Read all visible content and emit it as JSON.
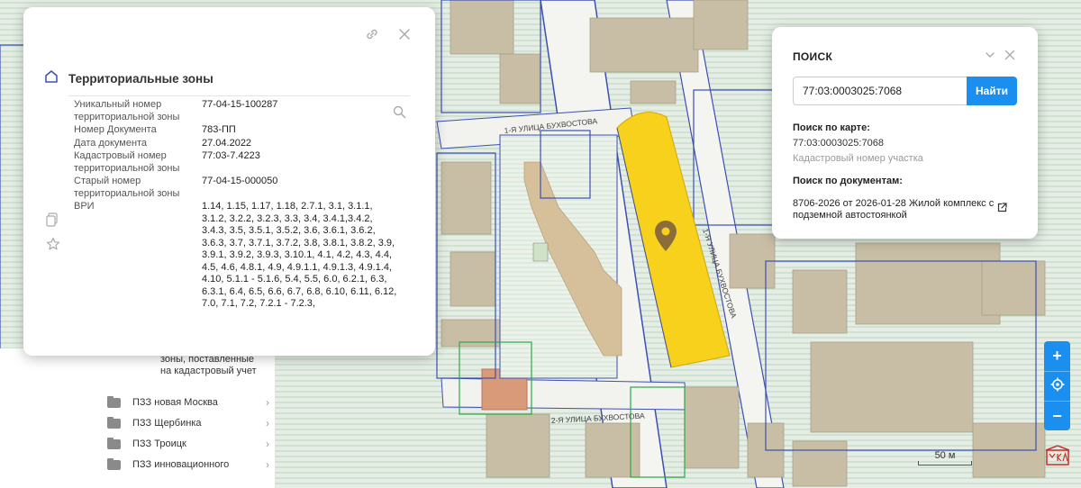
{
  "map": {
    "streets": [
      "1-Я УЛИЦА БУХВОСТОВА",
      "1-Я УЛИЦА БУХВОСТОВА",
      "2-Я УЛИЦА БУХВОСТОВА"
    ],
    "highlight_color": "#f7d11b",
    "marker_icon": "map-pin-icon"
  },
  "info_card": {
    "title": "Территориальные зоны",
    "icons": {
      "link": "link-icon",
      "close": "close-icon",
      "zoom": "zoom-icon",
      "layer": "layer-icon",
      "favorite": "star-icon"
    },
    "attributes": [
      {
        "label": "Уникальный номер территориальной зоны",
        "value": "77-04-15-100287"
      },
      {
        "label": "Номер Документа",
        "value": "783-ПП"
      },
      {
        "label": "Дата документа",
        "value": "27.04.2022"
      },
      {
        "label": "Кадастровый номер территориальной зоны",
        "value": "77:03-7.4223"
      },
      {
        "label": "Старый номер территориальной зоны",
        "value": "77-04-15-000050"
      },
      {
        "label": "ВРИ",
        "value": "1.14, 1.15, 1.17, 1.18, 2.7.1, 3.1, 3.1.1, 3.1.2, 3.2.2, 3.2.3, 3.3, 3.4, 3.4.1,3.4.2, 3.4.3, 3.5, 3.5.1, 3.5.2, 3.6, 3.6.1, 3.6.2, 3.6.3, 3.7, 3.7.1, 3.7.2, 3.8, 3.8.1, 3.8.2, 3.9, 3.9.1, 3.9.2, 3.9.3, 3.10.1, 4.1, 4.2, 4.3, 4.4, 4.5, 4.6, 4.8.1, 4.9, 4.9.1.1, 4.9.1.3, 4.9.1.4, 4.10, 5.1.1 - 5.1.6, 5.4, 5.5, 6.0, 6.2.1, 6.3, 6.3.1, 6.4, 6.5, 6.6, 6.7, 6.8, 6.10, 6.11, 6.12, 7.0, 7.1, 7.2, 7.2.1 - 7.2.3,"
      }
    ]
  },
  "layer_tree": {
    "partial_text": "зоны, поставленные на кадастровый учет",
    "items": [
      {
        "label": "ПЗЗ новая Москва"
      },
      {
        "label": "ПЗЗ Щербинка"
      },
      {
        "label": "ПЗЗ Троицк"
      },
      {
        "label": "ПЗЗ инновационного"
      }
    ]
  },
  "search": {
    "title": "ПОИСК",
    "input_value": "77:03:0003025:7068",
    "button_label": "Найти",
    "map_label": "Поиск по карте:",
    "map_result": "77:03:0003025:7068",
    "map_result_type": "Кадастровый номер участка",
    "docs_label": "Поиск по документам:",
    "doc_result": "8706-2026 от 2026-01-28 Жилой комплекс с подземной автостоянкой"
  },
  "controls": {
    "zoom_in": "+",
    "zoom_out": "−",
    "scale_label": "50 м",
    "accent": "#1a8ff0"
  }
}
